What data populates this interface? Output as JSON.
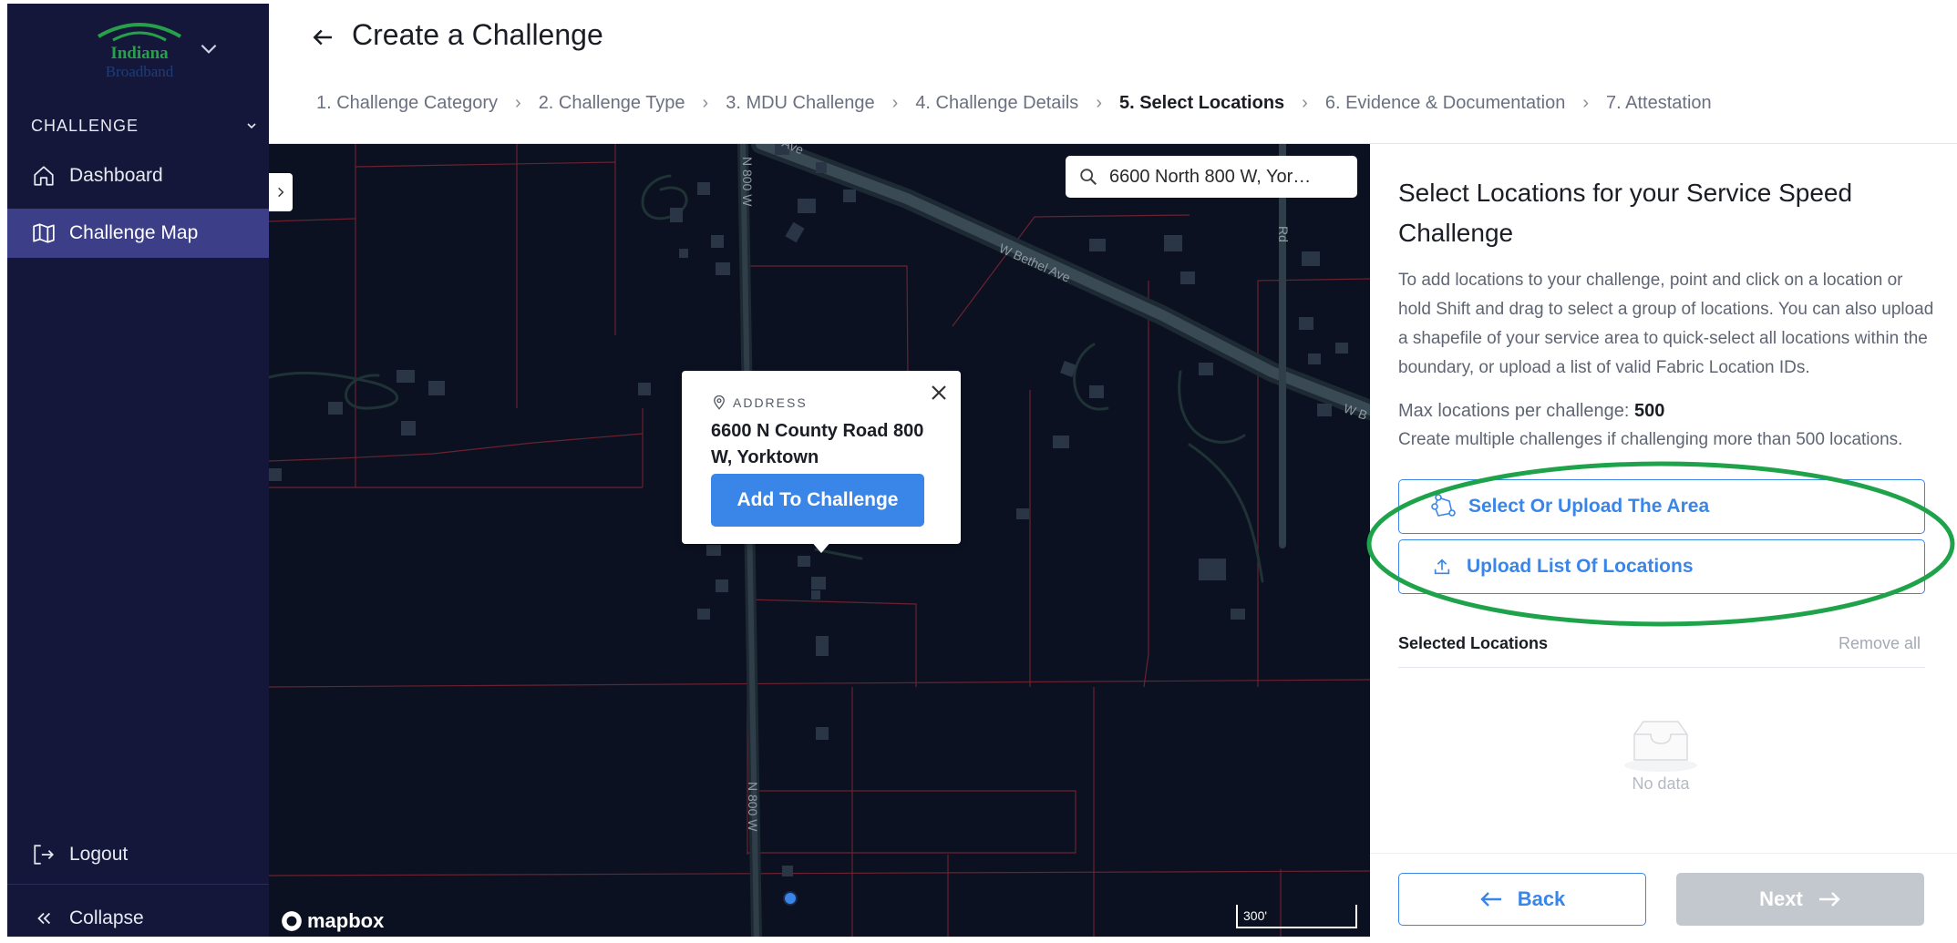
{
  "sidebar": {
    "logo_text_top": "Indiana",
    "logo_text_bottom": "Broadband",
    "section_label": "CHALLENGE",
    "items": [
      {
        "label": "Dashboard",
        "icon": "home-icon",
        "active": false
      },
      {
        "label": "Challenge Map",
        "icon": "map-icon",
        "active": true
      }
    ],
    "logout_label": "Logout",
    "collapse_label": "Collapse"
  },
  "header": {
    "title": "Create a Challenge",
    "steps": [
      {
        "label": "1. Challenge Category",
        "current": false
      },
      {
        "label": "2. Challenge Type",
        "current": false
      },
      {
        "label": "3. MDU Challenge",
        "current": false
      },
      {
        "label": "4. Challenge Details",
        "current": false
      },
      {
        "label": "5. Select Locations",
        "current": true
      },
      {
        "label": "6. Evidence & Documentation",
        "current": false
      },
      {
        "label": "7. Attestation",
        "current": false
      }
    ]
  },
  "map": {
    "search_value": "6600 North 800 W, Yor…",
    "road_labels": [
      "W Bethel Ave",
      "N 800 W",
      "N 800 W",
      "Ave",
      "W B",
      "Rd"
    ],
    "popup": {
      "label": "ADDRESS",
      "address": "6600 N County Road 800 W, Yorktown",
      "button_label": "Add To Challenge"
    },
    "attribution": "mapbox",
    "scale_label": "300'"
  },
  "panel": {
    "title": "Select Locations for your Service Speed Challenge",
    "description": "To add locations to your challenge, point and click on a location or hold Shift and drag to select a group of locations. You can also upload a shapefile of your service area to quick-select all locations within the boundary, or upload a list of valid Fabric Location IDs.",
    "max_label": "Max locations per challenge: ",
    "max_value": "500",
    "multi_note": "Create multiple challenges if challenging more than 500 locations.",
    "select_area_label": "Select Or Upload The Area",
    "upload_list_label": "Upload List Of Locations",
    "selected_label": "Selected Locations",
    "remove_all_label": "Remove all",
    "empty_text": "No data",
    "back_label": "Back",
    "next_label": "Next"
  },
  "colors": {
    "sidebar_bg": "#15173a",
    "sidebar_active": "#3c3f87",
    "accent": "#3a86e8",
    "map_bg": "#0b1120",
    "highlight_ellipse": "#1fa34a",
    "disabled": "#c3c7ce"
  }
}
